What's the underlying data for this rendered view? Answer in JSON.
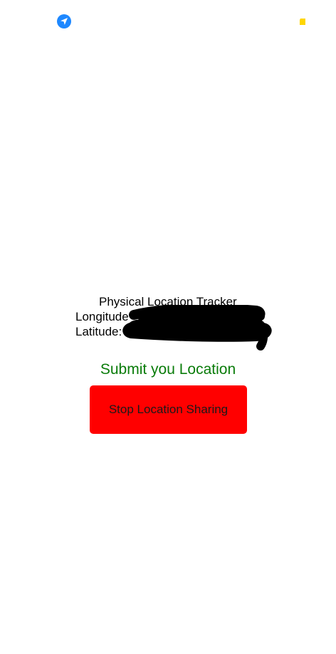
{
  "status_bar": {
    "left_icon": "location-arrow-icon",
    "right_icon": "battery-indicator-icon",
    "left_icon_color": "#1e88ff",
    "right_icon_color": "#ffd600"
  },
  "tracker": {
    "title": "Physical Location Tracker",
    "longitude_label": "Longitude",
    "latitude_label": "Latitude:"
  },
  "actions": {
    "submit_label": "Submit you Location",
    "stop_label": "Stop Location Sharing",
    "submit_color": "#0a7c0a",
    "stop_color": "#ff0000"
  }
}
